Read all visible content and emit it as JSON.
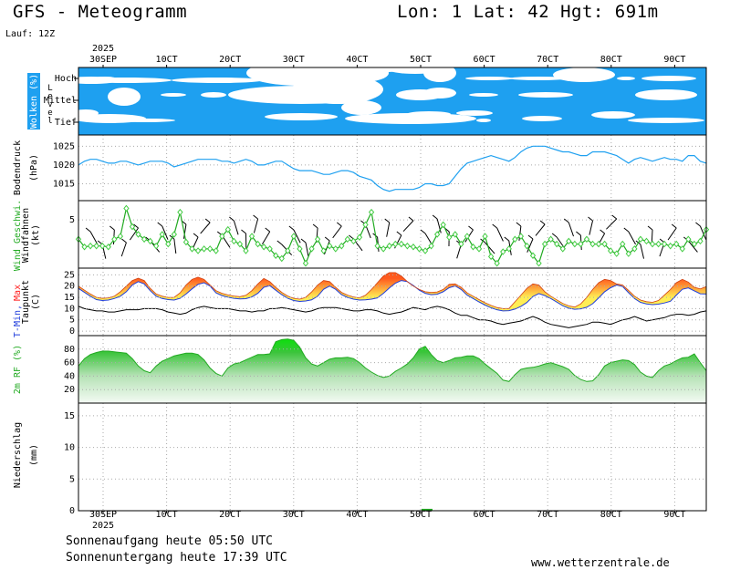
{
  "header": {
    "title": "GFS - Meteogramm",
    "location": "Lon: 1 Lat: 42 Hgt: 691m",
    "run": "Lauf: 12Z"
  },
  "footer": {
    "sunrise": "Sonnenaufgang heute 05:50 UTC",
    "sunset": "Sonnenuntergang heute 17:39 UTC",
    "source": "www.wetterzentrale.de"
  },
  "colors": {
    "cloud_sky": "#1ea0f0",
    "pressure": "#1ea0f0",
    "wind_line": "#22aa22",
    "wind_marker": "#44cc44",
    "temp_fill_low": "#ffee55",
    "temp_fill_high": "#ff5a1e",
    "tmin": "#1e3cdc",
    "tmax": "#ff2020",
    "dewpoint": "#000000",
    "rh": "#22aa22",
    "precip": "#22aa22",
    "grid": "#aaaaaa"
  },
  "chart_data": {
    "type": "line",
    "x_axis": {
      "year": "2025",
      "ticks": [
        "30SEP",
        "10CT",
        "20CT",
        "30CT",
        "40CT",
        "50CT",
        "60CT",
        "70CT",
        "80CT",
        "90CT"
      ],
      "days_shown": 9.5
    },
    "clouds": {
      "ylabel": "Wolken (%)",
      "level_label": "Level",
      "levels": [
        "Hoch",
        "Mittel",
        "Tief"
      ]
    },
    "pressure": {
      "ylabel": "Bodendruck",
      "unit": "(hPa)",
      "yticks": [
        1015,
        1020,
        1025
      ],
      "ylim": [
        1010.5,
        1028
      ],
      "values": [
        1020,
        1021,
        1021.5,
        1021.5,
        1021,
        1020.5,
        1020.5,
        1021,
        1021,
        1020.5,
        1020,
        1020.5,
        1021,
        1021,
        1021,
        1020.5,
        1019.5,
        1020,
        1020.5,
        1021,
        1021.5,
        1021.5,
        1021.5,
        1021.5,
        1021,
        1021,
        1020.5,
        1021,
        1021.5,
        1021,
        1020,
        1020,
        1020.5,
        1021,
        1021,
        1020,
        1019,
        1018.5,
        1018.5,
        1018.5,
        1018,
        1017.5,
        1017.5,
        1018,
        1018.5,
        1018.5,
        1018,
        1017,
        1016.5,
        1016,
        1014.5,
        1013.5,
        1013,
        1013.5,
        1013.5,
        1013.5,
        1013.5,
        1014,
        1015,
        1015,
        1014.5,
        1014.5,
        1015,
        1017,
        1019,
        1020.5,
        1021,
        1021.5,
        1022,
        1022.5,
        1022,
        1021.5,
        1021,
        1022,
        1023.5,
        1024.5,
        1025,
        1025,
        1025,
        1024.5,
        1024,
        1023.5,
        1023.5,
        1023,
        1022.5,
        1022.5,
        1023.5,
        1023.5,
        1023.5,
        1023,
        1022.5,
        1021.5,
        1020.5,
        1021.5,
        1022,
        1021.5,
        1021,
        1021.5,
        1022,
        1021.5,
        1021.5,
        1021,
        1022.5,
        1022.5,
        1021,
        1020.5
      ]
    },
    "wind": {
      "ylabel": "Wind Geschwi.",
      "ylabel2": "Windfahnen",
      "unit": "(kt)",
      "yticks": [
        5
      ],
      "ylim": [
        0,
        7
      ],
      "values": [
        3,
        2.2,
        2.3,
        2.3,
        2.3,
        2.2,
        3,
        3.3,
        6.2,
        4.3,
        3.5,
        3,
        2.8,
        2.3,
        3.5,
        2.5,
        3.5,
        5.8,
        2.7,
        2,
        1.8,
        2,
        2,
        1.8,
        3.3,
        4,
        2.8,
        2.5,
        1.8,
        3.3,
        2.5,
        2.2,
        2,
        1.3,
        1,
        1.8,
        3.3,
        2,
        0.5,
        2,
        3,
        1.8,
        2.3,
        2,
        2.3,
        3,
        2.8,
        3.2,
        4.5,
        5.8,
        2.3,
        2,
        2.3,
        2.5,
        2.5,
        2.3,
        2.2,
        2,
        1.8,
        2.3,
        3.5,
        4.5,
        3.2,
        3.5,
        2.5,
        3.3,
        2.2,
        2,
        3.3,
        1.2,
        0.5,
        1.7,
        2,
        3,
        3.3,
        2.3,
        1.3,
        0.5,
        2.5,
        3,
        2.5,
        2,
        2.8,
        2.5,
        2.5,
        3,
        2.5,
        2.5,
        2.5,
        1.8,
        1.5,
        2.5,
        1.5,
        2,
        3,
        2.8,
        2.5,
        2.5,
        2.5,
        2.3,
        2.5,
        2,
        3,
        2.5,
        2.8,
        4
      ]
    },
    "temperature": {
      "ylabel_tmin": "T-Min,",
      "ylabel_tmax": "Max",
      "ylabel2": "Taupunkt",
      "unit": "(C)",
      "yticks": [
        0,
        5,
        10,
        15,
        20,
        25
      ],
      "ylim": [
        -2,
        28
      ],
      "tmin": [
        19,
        17.2,
        15.5,
        14,
        13.6,
        13.8,
        14.5,
        15.5,
        17.5,
        20.5,
        22,
        21,
        18,
        15.5,
        14.5,
        14,
        13.8,
        14.6,
        16.5,
        18.8,
        20.8,
        21.5,
        20,
        17,
        15.8,
        15.1,
        14.6,
        14.3,
        14.4,
        15.2,
        16.8,
        19.5,
        20.2,
        18.2,
        16.2,
        14.6,
        13.6,
        13.2,
        13.4,
        13.9,
        15.5,
        18.6,
        20,
        18.6,
        16.2,
        15,
        14.2,
        13.8,
        13.9,
        14.2,
        14.8,
        16.8,
        19.2,
        21.3,
        22.5,
        22,
        20.3,
        18.2,
        16.8,
        16.2,
        16.4,
        17.5,
        19.3,
        20.1,
        18.5,
        16,
        14.5,
        13,
        11.6,
        10.4,
        9.5,
        9,
        9.1,
        9.8,
        11,
        12.7,
        15.4,
        16.7,
        15.8,
        14.5,
        12.9,
        11.3,
        10.2,
        9.7,
        9.9,
        10.6,
        12.2,
        14.8,
        17.5,
        19.3,
        20.5,
        19.8,
        17.1,
        14.5,
        12.8,
        12.1,
        11.8,
        12,
        12.5,
        13.3,
        16,
        18.6,
        19.2,
        17.9,
        16.6,
        16.5
      ],
      "tmax": [
        20,
        18.2,
        16.5,
        15,
        14.6,
        14.8,
        15.5,
        17.5,
        20,
        22.5,
        23.5,
        22.5,
        19,
        16.5,
        15.5,
        15,
        15,
        17,
        20.5,
        23,
        24,
        23,
        20.5,
        18,
        16.8,
        16.1,
        15.6,
        15.3,
        15.9,
        18,
        21,
        23.4,
        22,
        19.5,
        17.2,
        15.6,
        14.6,
        14.2,
        15,
        17.4,
        20.5,
        22.5,
        22,
        19.5,
        17.2,
        16,
        15.2,
        14.8,
        15.9,
        18.5,
        21.5,
        24.5,
        26,
        26,
        24.5,
        22,
        20,
        18.5,
        17.5,
        17.2,
        17.4,
        18.5,
        20.8,
        21,
        19.5,
        17,
        15.5,
        14,
        12.6,
        11.4,
        10.5,
        10,
        10.1,
        13,
        16,
        19,
        21,
        20.5,
        17.5,
        15.5,
        13.9,
        12.3,
        11.2,
        10.7,
        12.1,
        15,
        18.5,
        21.5,
        23,
        22.5,
        21,
        20.5,
        18.1,
        15.5,
        13.8,
        13.1,
        12.8,
        13.6,
        16,
        18.5,
        21.5,
        23,
        21.8,
        19.5,
        18.8,
        19.8
      ],
      "dewpoint": [
        11,
        10,
        9.5,
        9,
        9,
        8.5,
        8.5,
        9,
        9.5,
        9.5,
        9.5,
        10,
        10,
        10,
        9.5,
        8.5,
        8,
        7.5,
        8,
        9.5,
        10.5,
        11,
        10.5,
        10,
        10,
        10,
        9.5,
        9,
        9,
        8.5,
        9,
        9,
        10,
        10,
        10.5,
        10,
        9.5,
        9,
        8.5,
        9,
        10,
        10.5,
        10.5,
        10.5,
        10,
        9.5,
        9,
        9,
        9.5,
        9.5,
        9,
        8,
        7.5,
        8,
        8.5,
        9.5,
        10.5,
        10,
        9.5,
        10.5,
        11,
        10.5,
        9.5,
        8,
        7,
        7,
        6,
        5,
        5,
        4.5,
        3.5,
        3,
        3.5,
        4,
        4.5,
        5.5,
        6.5,
        5.5,
        4,
        3,
        2.5,
        2,
        1.5,
        2,
        2.5,
        3,
        4,
        4,
        3.5,
        3,
        4,
        5,
        5.5,
        6.5,
        5.5,
        4.5,
        5,
        5.5,
        6,
        7,
        7.5,
        7.5,
        7,
        7.5,
        8.5,
        9
      ]
    },
    "humidity": {
      "ylabel": "2m RF (%)",
      "yticks": [
        20,
        40,
        60,
        80
      ],
      "ylim": [
        0,
        100
      ],
      "values": [
        55,
        66,
        72,
        75,
        77,
        77,
        76,
        75,
        74,
        66,
        55,
        48,
        45,
        55,
        62,
        66,
        70,
        72,
        74,
        74,
        72,
        64,
        52,
        44,
        40,
        52,
        58,
        60,
        64,
        68,
        72,
        72,
        73,
        91,
        94,
        95,
        93,
        83,
        67,
        58,
        55,
        60,
        65,
        67,
        67,
        68,
        66,
        60,
        52,
        46,
        41,
        38,
        40,
        47,
        52,
        58,
        67,
        80,
        84,
        72,
        63,
        60,
        63,
        67,
        68,
        70,
        70,
        66,
        58,
        51,
        44,
        34,
        32,
        42,
        50,
        52,
        53,
        55,
        58,
        60,
        57,
        54,
        50,
        41,
        35,
        32,
        33,
        42,
        55,
        60,
        62,
        64,
        63,
        57,
        46,
        40,
        38,
        48,
        55,
        58,
        63,
        67,
        68,
        73,
        60,
        48
      ]
    },
    "precipitation": {
      "ylabel": "Niederschlag",
      "unit": "(mm)",
      "yticks": [
        0,
        5,
        10,
        15
      ],
      "ylim": [
        0,
        17
      ],
      "events": [
        {
          "day": 5.1,
          "value": 0.3
        }
      ]
    }
  }
}
